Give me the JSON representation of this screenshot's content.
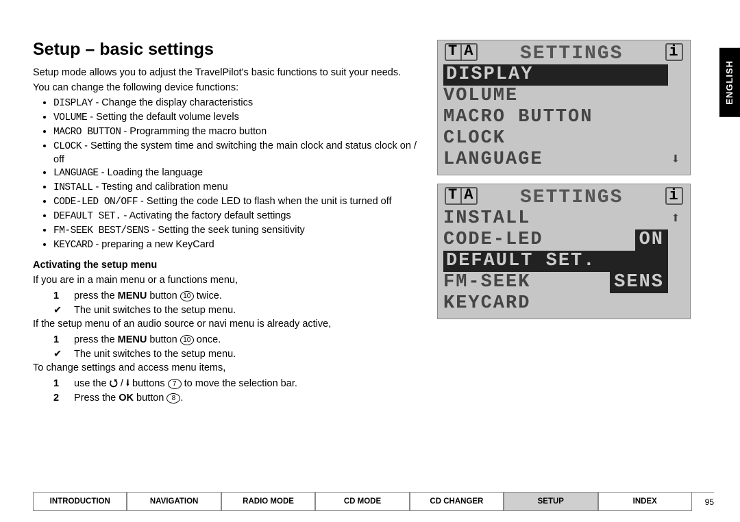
{
  "title": "Setup – basic settings",
  "intro": "Setup mode allows you to adjust the TravelPilot's basic functions to suit your needs.",
  "lead": "You can change the following device functions:",
  "bullets": [
    {
      "code": "DISPLAY",
      "text": " - Change the display characteristics"
    },
    {
      "code": "VOLUME",
      "text": " - Setting the default volume levels"
    },
    {
      "code": "MACRO BUTTON",
      "text": " - Programming the macro button"
    },
    {
      "code": "CLOCK",
      "text": " - Setting the system time and switching the main clock and status clock on / off"
    },
    {
      "code": "LANGUAGE",
      "text": " - Loading the language"
    },
    {
      "code": "INSTALL",
      "text": " - Testing and calibration menu"
    },
    {
      "code": "CODE-LED ON/OFF",
      "text": " - Setting the code LED to flash when the unit is turned off"
    },
    {
      "code": "DEFAULT SET.",
      "text": " - Activating the factory default settings"
    },
    {
      "code": "FM-SEEK BEST/SENS",
      "text": " - Setting the seek tuning sensitivity"
    },
    {
      "code": "KEYCARD",
      "text": " - preparing a new KeyCard"
    }
  ],
  "subheading": "Activating the setup menu",
  "p1": "If you are in a main menu or a functions menu,",
  "step1_pre": "press the ",
  "step1_bold": "MENU",
  "step1_post": " button ",
  "step1_ref": "10",
  "step1_end": " twice.",
  "check1": "The unit switches to the setup menu.",
  "p2": "If the setup menu of an audio source or navi menu is already active,",
  "step2_pre": "press the ",
  "step2_bold": "MENU",
  "step2_post": " button ",
  "step2_ref": "10",
  "step2_end": " once.",
  "check2": "The unit switches to the setup menu.",
  "p3": "To change settings and access menu items,",
  "step3a_pre": "use the ",
  "step3a_sym": "⤒ / ⤓",
  "step3a_post": " buttons ",
  "step3a_ref": "7",
  "step3a_end": " to move the selection bar.",
  "step3b_pre": "Press the ",
  "step3b_bold": "OK",
  "step3b_post": " button ",
  "step3b_ref": "8",
  "step3b_end": ".",
  "lang_tab": "ENGLISH",
  "lcd1": {
    "title": "SETTINGS",
    "rows": [
      "DISPLAY",
      "VOLUME",
      "MACRO BUTTON",
      "CLOCK",
      "LANGUAGE"
    ],
    "selected": 0,
    "scroll": "down"
  },
  "lcd2": {
    "title": "SETTINGS",
    "rows": [
      {
        "label": "INSTALL",
        "tag": "",
        "scroll": "up"
      },
      {
        "label": "CODE-LED",
        "tag": "ON"
      },
      {
        "label": "DEFAULT SET.",
        "tag": "",
        "sel": true
      },
      {
        "label": "FM-SEEK",
        "tag": "SENS"
      },
      {
        "label": "KEYCARD",
        "tag": ""
      }
    ]
  },
  "footer": [
    "INTRODUCTION",
    "NAVIGATION",
    "RADIO MODE",
    "CD MODE",
    "CD CHANGER",
    "SETUP",
    "INDEX"
  ],
  "footer_active": 5,
  "page": "95"
}
